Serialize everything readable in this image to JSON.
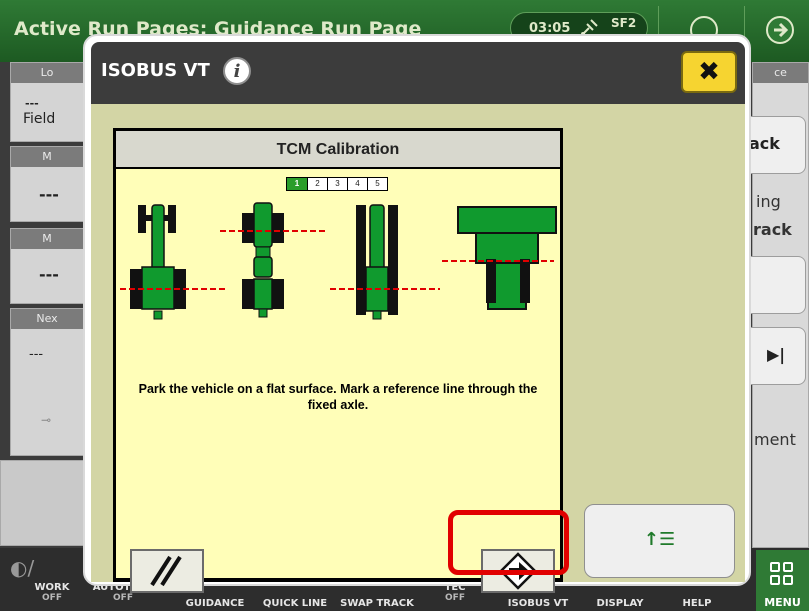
{
  "background": {
    "title": "Active Run Pages: Guidance Run Page",
    "clock": "03:05",
    "sf_label": "SF2",
    "left_panes": [
      {
        "head": "Lo",
        "value": "---",
        "sub": "Field"
      },
      {
        "head": "M",
        "value": "---"
      },
      {
        "head": "M",
        "value": "---"
      },
      {
        "head": "Nex",
        "value": "---"
      }
    ],
    "right_texts": {
      "head": "ce",
      "track_btn": "ack",
      "ing": "ing",
      "rack": "rack",
      "ment": "ment"
    },
    "bottom_tabs": [
      {
        "label": "WORK",
        "sub": "OFF"
      },
      {
        "label": "AUTOTRAC",
        "sub": "OFF"
      },
      {
        "label": "GUIDANCE",
        "sub": ""
      },
      {
        "label": "QUICK LINE",
        "sub": ""
      },
      {
        "label": "SWAP TRACK",
        "sub": ""
      },
      {
        "label": "TEC",
        "sub": "OFF"
      },
      {
        "label": "ISOBUS VT",
        "sub": ""
      },
      {
        "label": "DISPLAY",
        "sub": ""
      },
      {
        "label": "HELP",
        "sub": ""
      }
    ],
    "menu_label": "MENU"
  },
  "modal": {
    "title": "ISOBUS VT",
    "info_glyph": "i",
    "close_glyph": "✖",
    "mask": {
      "title": "TCM Calibration",
      "steps": [
        "1",
        "2",
        "3",
        "4",
        "5"
      ],
      "active_step": "1",
      "instruction": "Park the vehicle on a flat surface.  Mark a reference line through the fixed axle."
    },
    "side_button_glyph": "↑☰"
  },
  "colors": {
    "brand_green": "#2f7a35",
    "vehicle_green": "#109a2e",
    "reference_line": "#e00000",
    "mask_background": "#fffeb8",
    "highlight": "#e10000"
  }
}
